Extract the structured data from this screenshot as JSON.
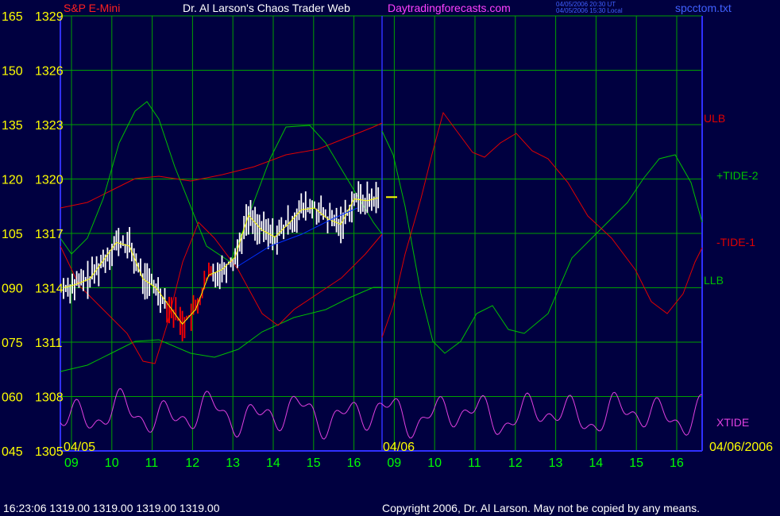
{
  "header": {
    "symbol": "S&P E-Mini",
    "title": "Dr. Al Larson's Chaos Trader Web",
    "site": "Daytradingforecasts.com",
    "ut_time": "04/05/2006 20:30 UT",
    "local_time": "04/05/2006 15:30 Local",
    "file": "spcctom.txt"
  },
  "footer": {
    "status": "16:23:06  1319.00 1319.00 1319.00 1319.00",
    "copyright": "Copyright 2006, Dr. Al Larson. May not be copied by any means."
  },
  "colors": {
    "background": "#000040",
    "grid": "#00a000",
    "axis": "#3030ff",
    "axis_label": "#ffff00",
    "time_label": "#00ff00",
    "price": "#ffffff",
    "price_down": "#ff0000",
    "avg": "#ffff00",
    "ma": "#0030ff",
    "red_curve": "#e00000",
    "green_curve": "#00c000",
    "xtide": "#e040e0"
  },
  "chart_data": {
    "type": "line",
    "title": "Dr. Al Larson's Chaos Trader Web",
    "y_left_scale": [
      "165",
      "150",
      "135",
      "120",
      "105",
      "090",
      "075",
      "060",
      "045"
    ],
    "y_price_scale": [
      "1329",
      "1326",
      "1323",
      "1320",
      "1317",
      "1314",
      "1311",
      "1308",
      "1305"
    ],
    "ylim_price": [
      1305,
      1329
    ],
    "x_hours": [
      "09",
      "10",
      "11",
      "12",
      "13",
      "14",
      "15",
      "16",
      "09",
      "10",
      "11",
      "12",
      "13",
      "14",
      "15",
      "16"
    ],
    "date_labels": [
      "04/05",
      "04/06",
      "04/06/2006"
    ],
    "series_labels": [
      "ULB",
      "+TIDE-2",
      "-TIDE-1",
      "LLB",
      "XTIDE"
    ],
    "price_close_approx": [
      1314,
      1314.2,
      1314.5,
      1315.5,
      1316.5,
      1316.3,
      1314.5,
      1314,
      1313,
      1312,
      1312.8,
      1314.7,
      1315,
      1315.7,
      1318,
      1317.2,
      1316.8,
      1317.5,
      1318.3,
      1318.4,
      1317.8,
      1317.5,
      1318.9,
      1318.8,
      1319.0
    ],
    "last_price": 1319.0
  }
}
